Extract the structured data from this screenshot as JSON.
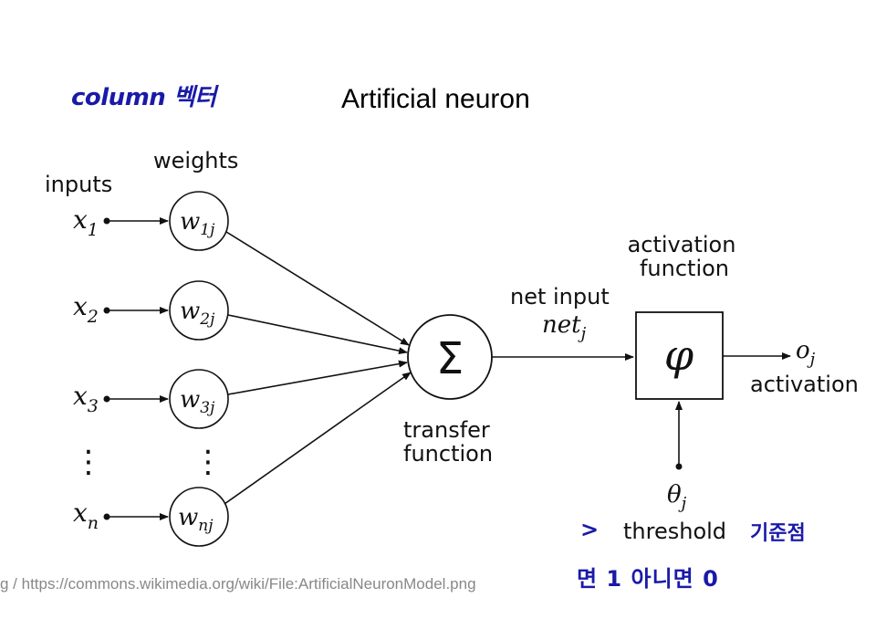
{
  "title": "Artificial neuron",
  "annotations": {
    "column_vector": "column 벡터",
    "arrow_mark": ">",
    "reference_point": "기준점",
    "rule": "면 1 아니면 0"
  },
  "source_credit": "g / https://commons.wikimedia.org/wiki/File:ArtificialNeuronModel.png",
  "diagram": {
    "labels": {
      "inputs": "inputs",
      "weights": "weights",
      "transfer_function_line1": "transfer",
      "transfer_function_line2": "function",
      "net_input": "net input",
      "activation_function_line1": "activation",
      "activation_function_line2": "function",
      "activation": "activation",
      "threshold": "threshold"
    },
    "inputs": [
      {
        "sym": "x",
        "sub": "1"
      },
      {
        "sym": "x",
        "sub": "2"
      },
      {
        "sym": "x",
        "sub": "3"
      },
      {
        "sym": "x",
        "sub": "n"
      }
    ],
    "weights": [
      {
        "sym": "w",
        "sub": "1j"
      },
      {
        "sym": "w",
        "sub": "2j"
      },
      {
        "sym": "w",
        "sub": "3j"
      },
      {
        "sym": "w",
        "sub": "nj"
      }
    ],
    "vdots": "⋮",
    "sum_symbol": "Σ",
    "net": {
      "sym": "net",
      "sub": "j"
    },
    "phi_symbol": "φ",
    "output": {
      "sym": "o",
      "sub": "j"
    },
    "theta": {
      "sym": "θ",
      "sub": "j"
    }
  },
  "colors": {
    "line": "#111111",
    "handwriting": "#1a1aa8",
    "source": "#888888"
  }
}
